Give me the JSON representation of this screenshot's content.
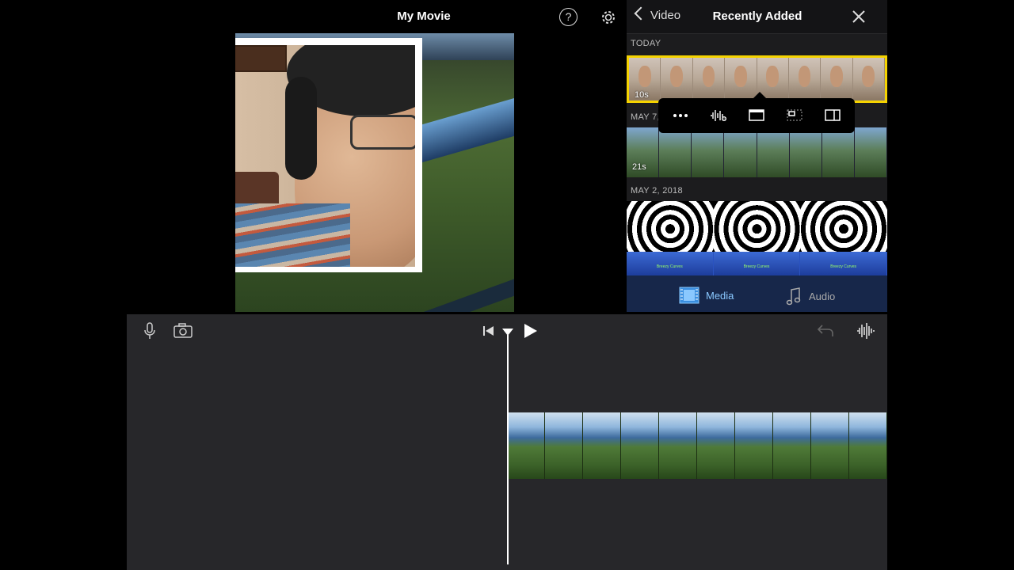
{
  "header": {
    "title": "My Movie",
    "help_symbol": "?"
  },
  "panel": {
    "back_label": "Video",
    "title": "Recently Added",
    "sections": [
      {
        "label": "TODAY",
        "duration": "10s"
      },
      {
        "label": "MAY 7, 2018",
        "duration": "21s"
      },
      {
        "label": "MAY 2, 2018",
        "duration": ""
      }
    ],
    "tabs": {
      "media": "Media",
      "audio": "Audio"
    },
    "banner_text": "Breezy Curves"
  },
  "colors": {
    "selection": "#f5d300",
    "accent": "#8ac8ff",
    "tab_bar": "#17274a"
  }
}
